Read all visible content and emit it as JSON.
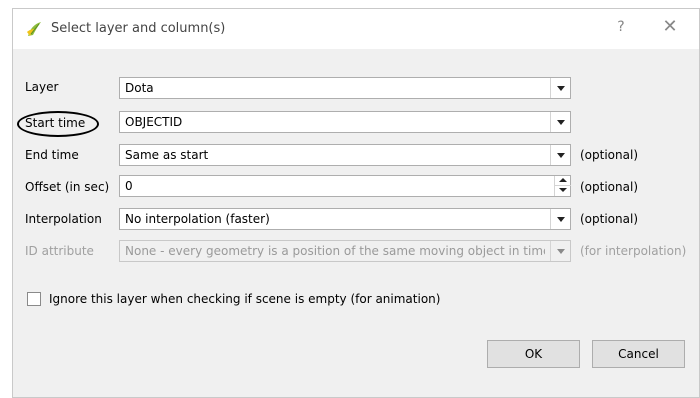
{
  "dialog": {
    "title": "Select layer and column(s)",
    "help": "?",
    "close": "✕"
  },
  "rows": {
    "layer": {
      "label": "Layer",
      "value": "Dota"
    },
    "start_time": {
      "label": "Start time",
      "value": "OBJECTID"
    },
    "end_time": {
      "label": "End time",
      "value": "Same as start",
      "hint": "(optional)"
    },
    "offset": {
      "label": "Offset (in sec)",
      "value": "0",
      "hint": "(optional)"
    },
    "interpolation": {
      "label": "Interpolation",
      "value": "No interpolation (faster)",
      "hint": "(optional)"
    },
    "id_attribute": {
      "label": "ID attribute",
      "value": "None - every geometry is a position of the same moving object in time",
      "hint": "(for interpolation)"
    }
  },
  "checkbox": {
    "label": "Ignore this layer when checking if scene is empty (for animation)",
    "checked": false
  },
  "buttons": {
    "ok": "OK",
    "cancel": "Cancel"
  }
}
